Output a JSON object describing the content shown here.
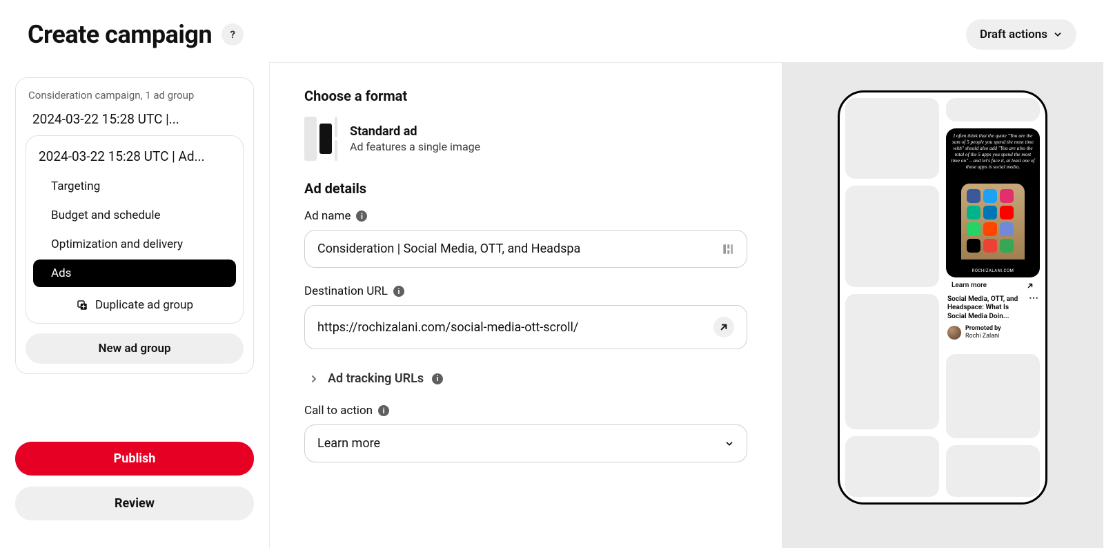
{
  "header": {
    "title": "Create campaign",
    "help_glyph": "?",
    "draft_actions": "Draft actions"
  },
  "sidebar": {
    "summary": "Consideration campaign, 1 ad group",
    "campaign_name": "2024-03-22 15:28 UTC |...",
    "adgroup_name": "2024-03-22 15:28 UTC | Ad...",
    "nav": [
      {
        "label": "Targeting",
        "active": false
      },
      {
        "label": "Budget and schedule",
        "active": false
      },
      {
        "label": "Optimization and delivery",
        "active": false
      },
      {
        "label": "Ads",
        "active": true
      }
    ],
    "duplicate": "Duplicate ad group",
    "new_ad_group": "New ad group",
    "publish": "Publish",
    "review": "Review"
  },
  "form": {
    "format_heading": "Choose a format",
    "format_title": "Standard ad",
    "format_desc": "Ad features a single image",
    "details_heading": "Ad details",
    "ad_name_label": "Ad name",
    "ad_name_value": "Consideration | Social Media, OTT, and Headspa",
    "dest_url_label": "Destination URL",
    "dest_url_value": "https://rochizalani.com/social-media-ott-scroll/",
    "tracking_label": "Ad tracking URLs",
    "cta_label": "Call to action",
    "cta_value": "Learn more"
  },
  "preview": {
    "pin_caption": "I often think that the quote \"You are the sum of 5 people you spend the most time with\" should also add \"You are also the total of the 5 apps you spend the most time on\" – and let's face it, at least one of those apps is social media.",
    "pin_site": "ROCHIZALANI.COM",
    "cta": "Learn more",
    "title": "Social Media, OTT, and Headspace: What Is Social Media Doin...",
    "promoter_line1": "Promoted by",
    "promoter_line2": "Rochi Zalani",
    "app_colors": [
      "#3b5998",
      "#1da1f2",
      "#e1306c",
      "#00b489",
      "#0077b5",
      "#ff0000",
      "#25d366",
      "#ff4500",
      "#7289da",
      "#000000",
      "#ea4335",
      "#34a853"
    ]
  }
}
